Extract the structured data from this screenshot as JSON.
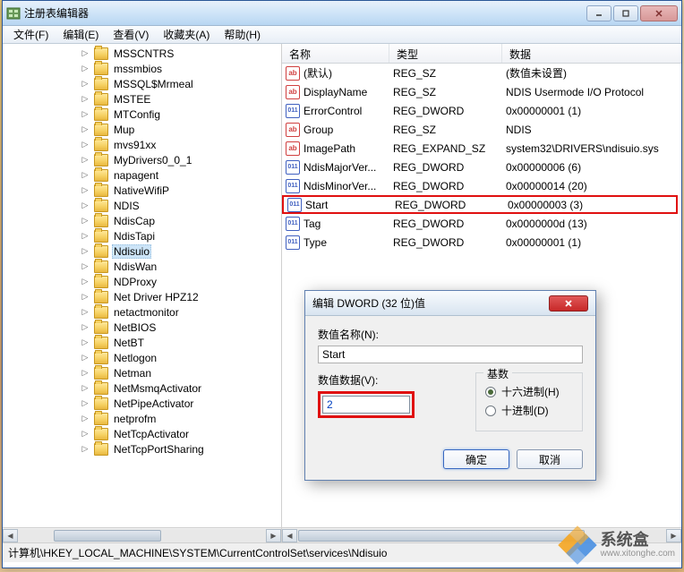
{
  "window": {
    "title": "注册表编辑器"
  },
  "menu": [
    {
      "label": "文件(F)"
    },
    {
      "label": "编辑(E)"
    },
    {
      "label": "查看(V)"
    },
    {
      "label": "收藏夹(A)"
    },
    {
      "label": "帮助(H)"
    }
  ],
  "tree": [
    {
      "label": "MSSCNTRS"
    },
    {
      "label": "mssmbios"
    },
    {
      "label": "MSSQL$Mrmeal"
    },
    {
      "label": "MSTEE"
    },
    {
      "label": "MTConfig"
    },
    {
      "label": "Mup"
    },
    {
      "label": "mvs91xx"
    },
    {
      "label": "MyDrivers0_0_1"
    },
    {
      "label": "napagent"
    },
    {
      "label": "NativeWifiP"
    },
    {
      "label": "NDIS"
    },
    {
      "label": "NdisCap"
    },
    {
      "label": "NdisTapi"
    },
    {
      "label": "Ndisuio",
      "selected": true
    },
    {
      "label": "NdisWan"
    },
    {
      "label": "NDProxy"
    },
    {
      "label": "Net Driver HPZ12"
    },
    {
      "label": "netactmonitor"
    },
    {
      "label": "NetBIOS"
    },
    {
      "label": "NetBT"
    },
    {
      "label": "Netlogon"
    },
    {
      "label": "Netman"
    },
    {
      "label": "NetMsmqActivator"
    },
    {
      "label": "NetPipeActivator"
    },
    {
      "label": "netprofm"
    },
    {
      "label": "NetTcpActivator"
    },
    {
      "label": "NetTcpPortSharing"
    }
  ],
  "list": {
    "headers": {
      "name": "名称",
      "type": "类型",
      "data": "数据"
    },
    "rows": [
      {
        "icon": "sz",
        "name": "(默认)",
        "type": "REG_SZ",
        "data": "(数值未设置)"
      },
      {
        "icon": "sz",
        "name": "DisplayName",
        "type": "REG_SZ",
        "data": "NDIS Usermode I/O Protocol"
      },
      {
        "icon": "dw",
        "name": "ErrorControl",
        "type": "REG_DWORD",
        "data": "0x00000001 (1)"
      },
      {
        "icon": "sz",
        "name": "Group",
        "type": "REG_SZ",
        "data": "NDIS"
      },
      {
        "icon": "sz",
        "name": "ImagePath",
        "type": "REG_EXPAND_SZ",
        "data": "system32\\DRIVERS\\ndisuio.sys"
      },
      {
        "icon": "dw",
        "name": "NdisMajorVer...",
        "type": "REG_DWORD",
        "data": "0x00000006 (6)"
      },
      {
        "icon": "dw",
        "name": "NdisMinorVer...",
        "type": "REG_DWORD",
        "data": "0x00000014 (20)"
      },
      {
        "icon": "dw",
        "name": "Start",
        "type": "REG_DWORD",
        "data": "0x00000003 (3)",
        "highlighted": true
      },
      {
        "icon": "dw",
        "name": "Tag",
        "type": "REG_DWORD",
        "data": "0x0000000d (13)"
      },
      {
        "icon": "dw",
        "name": "Type",
        "type": "REG_DWORD",
        "data": "0x00000001 (1)"
      }
    ]
  },
  "statusbar": {
    "path": "计算机\\HKEY_LOCAL_MACHINE\\SYSTEM\\CurrentControlSet\\services\\Ndisuio"
  },
  "dialog": {
    "title": "编辑 DWORD (32 位)值",
    "name_label": "数值名称(N):",
    "name_value": "Start",
    "data_label": "数值数据(V):",
    "data_value": "2",
    "base_label": "基数",
    "radio_hex": "十六进制(H)",
    "radio_dec": "十进制(D)",
    "ok": "确定",
    "cancel": "取消"
  },
  "watermark": {
    "cn": "系统盒",
    "en": "www.xitonghe.com"
  }
}
